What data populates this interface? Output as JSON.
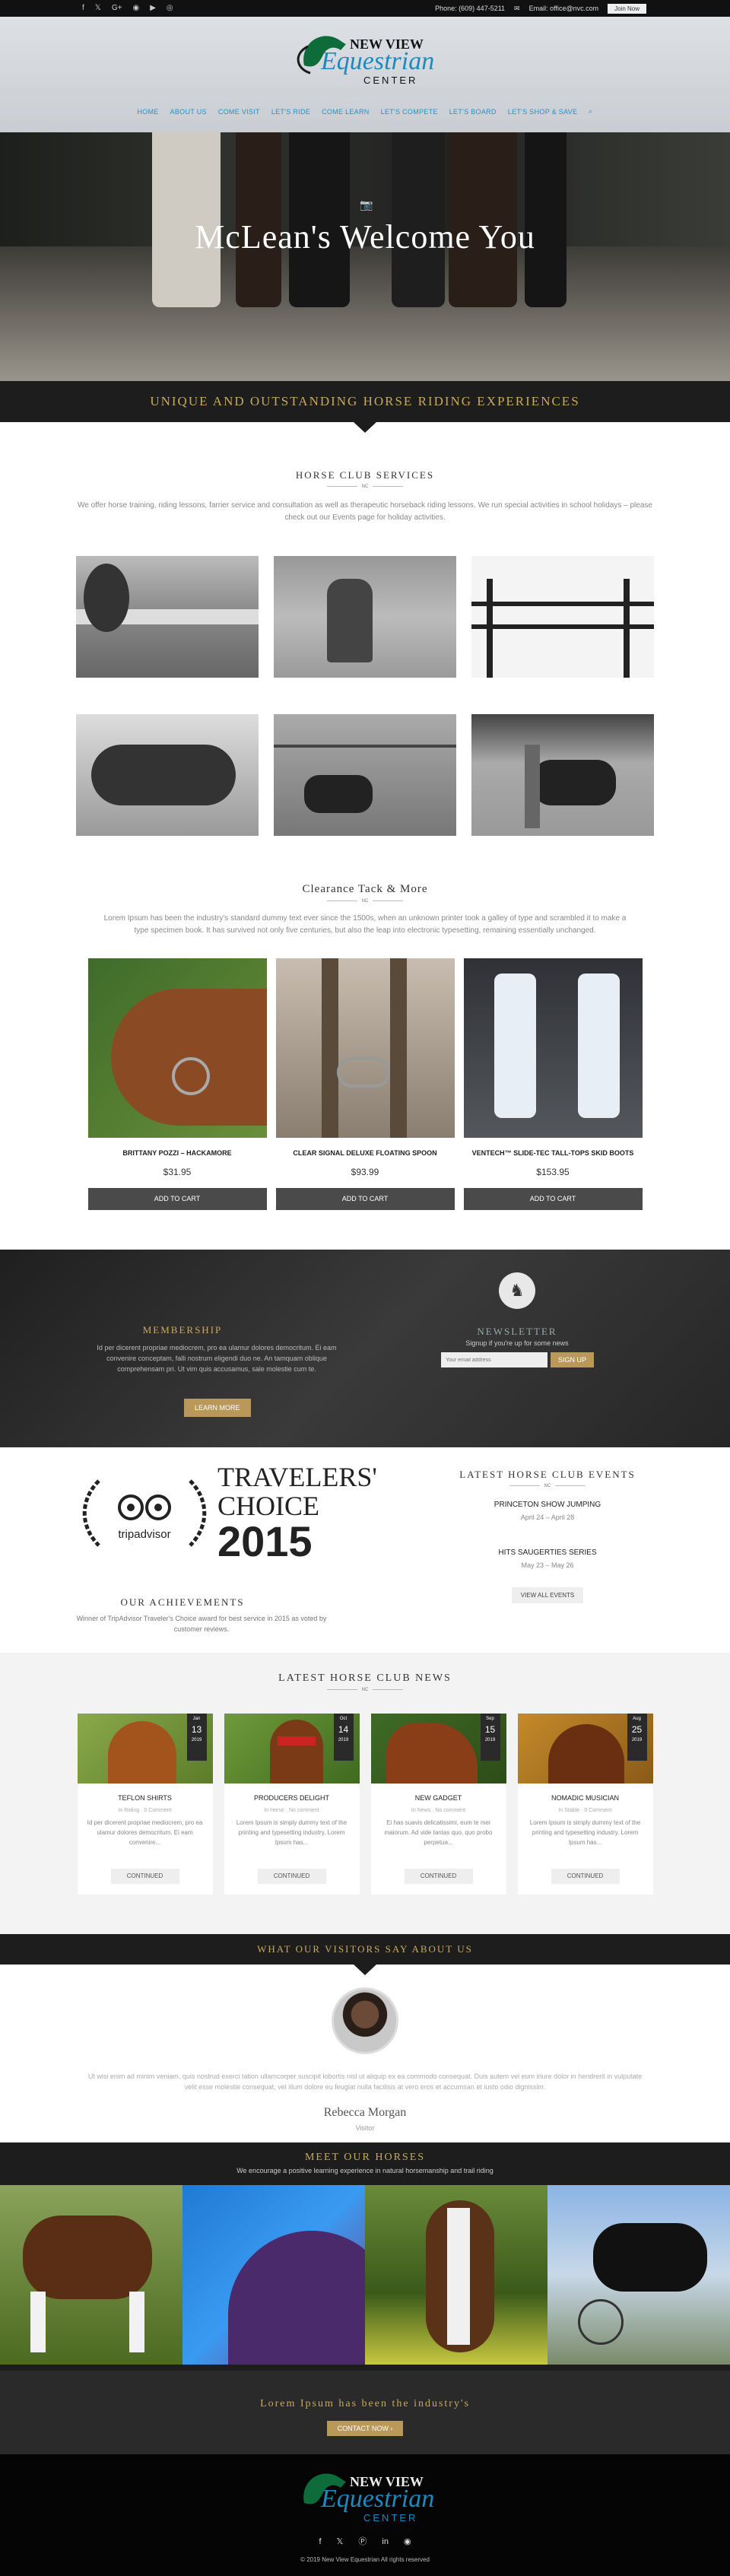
{
  "topbar": {
    "social": [
      "facebook-icon",
      "twitter-icon",
      "google-plus-icon",
      "instagram-icon",
      "youtube-icon",
      "tripadvisor-icon"
    ],
    "phone": "Phone: (609) 447-5211",
    "email": "Email: office@nvc.com",
    "join": "Join Now"
  },
  "logo": {
    "line1": "NEW VIEW",
    "line2": "Equestrian",
    "line3": "CENTER"
  },
  "nav": [
    "HOME",
    "ABOUT US",
    "COME VISIT",
    "LET'S RIDE",
    "COME LEARN",
    "LET'S COMPETE",
    "LET'S BOARD",
    "LET'S SHOP & SAVE"
  ],
  "hero": {
    "title": "McLean's Welcome You"
  },
  "banner": {
    "title": "UNIQUE AND OUTSTANDING HORSE RIDING EXPERIENCES"
  },
  "services": {
    "title": "HORSE CLUB SERVICES",
    "sub": "NC",
    "text": "We offer horse training, riding lessons, farrier service and consultation as well as therapeutic horseback riding lessons. We run special activities in school holidays – please check out our Events page for holiday activities."
  },
  "clearance": {
    "title": "Clearance Tack & More",
    "sub": "NC",
    "text": "Lorem Ipsum has been the industry's standard dummy text ever since the 1500s, when an unknown printer took a galley of type and scrambled it to make a type specimen book. It has survived not only five centuries, but also the leap into electronic typesetting, remaining essentially unchanged.",
    "products": [
      {
        "name": "BRITTANY POZZI – HACKAMORE",
        "price": "$31.95",
        "button": "ADD TO CART"
      },
      {
        "name": "CLEAR SIGNAL DELUXE FLOATING SPOON",
        "price": "$93.99",
        "button": "ADD TO CART"
      },
      {
        "name": "VENTECH™ SLIDE-TEC TALL-TOPS SKID BOOTS",
        "price": "$153.95",
        "button": "ADD TO CART"
      }
    ]
  },
  "membership": {
    "title": "MEMBERSHIP",
    "text": "Id per dicerent propriae mediocrem, pro ea ulamur dolores democritum. Ei eam convenire conceptam, falli nostrum eligendi duo ne. An tamquam oblique comprehensam pri. Ut vim quis accusamus, sale molestie cum te.",
    "button": "LEARN MORE"
  },
  "newsletter": {
    "title": "NEWSLETTER",
    "text": "Signup if you're up for some news",
    "placeholder": "Your email address",
    "button": "SIGN UP"
  },
  "achievements": {
    "badge_line1": "TRAVELERS'",
    "badge_line2": "CHOICE",
    "badge_year": "2015",
    "badge_brand": "tripadvisor",
    "title": "OUR ACHIEVEMENTS",
    "text": "Winner of TripAdvisor Traveler's Choice award for best service in 2015 as voted by customer reviews."
  },
  "events": {
    "title": "LATEST HORSE CLUB EVENTS",
    "sub": "NC",
    "items": [
      {
        "name": "PRINCETON SHOW JUMPING",
        "date": "April 24 – April 28"
      },
      {
        "name": "HITS SAUGERTIES SERIES",
        "date": "May 23 – May 26"
      }
    ],
    "button": "VIEW ALL EVENTS"
  },
  "news": {
    "title": "LATEST HORSE CLUB NEWS",
    "sub": "NC",
    "items": [
      {
        "month": "Jan",
        "day": "13",
        "year": "2019",
        "title": "TEFLON SHIRTS",
        "meta": "In Riding  ·  0 Comment",
        "text": "Id per dicerent propriae mediocrem, pro ea ulamur dolores democritum. Ei eam convenire...",
        "button": "CONTINUED"
      },
      {
        "month": "Oct",
        "day": "14",
        "year": "2019",
        "title": "PRODUCERS DELIGHT",
        "meta": "In Horse  ·  No comment",
        "text": "Lorem Ipsum is simply dummy text of the printing and typesetting industry. Lorem Ipsum has...",
        "button": "CONTINUED"
      },
      {
        "month": "Sep",
        "day": "15",
        "year": "2019",
        "title": "NEW GADGET",
        "meta": "In News  ·  No comment",
        "text": "Ei has suavis delicatissimi, eum te mei maiorum. Ad vide tantas quo, quo probo perpetua...",
        "button": "CONTINUED"
      },
      {
        "month": "Aug",
        "day": "25",
        "year": "2019",
        "title": "NOMADIC MUSICIAN",
        "meta": "In Stable  ·  0 Comment",
        "text": "Lorem Ipsum is simply dummy text of the printing and typesetting industry. Lorem Ipsum has...",
        "button": "CONTINUED"
      }
    ]
  },
  "testimonials": {
    "title": "WHAT OUR VISITORS SAY ABOUT US",
    "quote": "Ut wisi enim ad minim veniam, quis nostrud exerci tation ullamcorper suscipit lobortis nisl ut aliquip ex ea commodo consequat. Duis autem vel eum iriure dolor in hendrerit in vulputate velit esse molestie consequat, vel illum dolore eu feugiat nulla facilisis at vero eros et accumsan et iusto odio dignissim.",
    "name": "Rebecca Morgan",
    "role": "Visitor"
  },
  "horses": {
    "title": "MEET OUR HORSES",
    "text": "We encourage a positive learning experience in natural horsemanship and trail riding"
  },
  "cta": {
    "title": "Lorem Ipsum has been the industry's",
    "button": "CONTACT NOW"
  },
  "footer": {
    "social": [
      "facebook-icon",
      "twitter-icon",
      "pinterest-icon",
      "linkedin-icon",
      "instagram-icon"
    ],
    "copyright": "© 2019 New View Equestrian All rights reserved"
  },
  "colors": {
    "gold": "#c9a95c",
    "nav_blue": "#2a8fc4",
    "dark": "#1d1d1d"
  }
}
